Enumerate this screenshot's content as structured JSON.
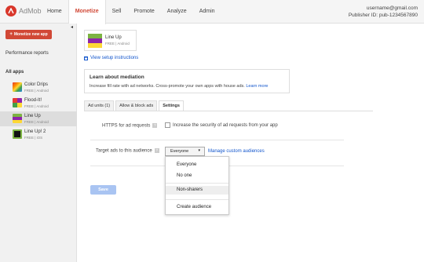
{
  "header": {
    "logo_text": "AdMob",
    "nav": [
      "Home",
      "Monetize",
      "Sell",
      "Promote",
      "Analyze",
      "Admin"
    ],
    "active_nav": "Monetize",
    "email": "username@gmail.com",
    "publisher": "Publisher ID: pub-1234567890"
  },
  "sidebar": {
    "collapse_glyph": "◂",
    "monetize_button": "Monetize new app",
    "performance_reports": "Performance reports",
    "all_apps": "All apps",
    "apps": [
      {
        "name": "Color Drips",
        "sub": "FREE | Android"
      },
      {
        "name": "Flood-It!",
        "sub": "FREE | Android"
      },
      {
        "name": "Line Up",
        "sub": "FREE | Android"
      },
      {
        "name": "Line Up! 2",
        "sub": "FREE | iOS"
      }
    ]
  },
  "main": {
    "app_card": {
      "name": "Line Up",
      "sub": "FREE | Android"
    },
    "setup_link": "View setup instructions",
    "mediation": {
      "title": "Learn about mediation",
      "text": "Increase fill rate with ad networks. Cross-promote your own apps with house ads.",
      "link": "Learn more"
    },
    "tabs": [
      "Ad units (1)",
      "Allow & block ads",
      "Settings"
    ],
    "https": {
      "label": "HTTPS for ad requests",
      "checkbox_label": "Increase the security of ad requests from your app"
    },
    "target": {
      "label": "Target ads to this audience",
      "selected": "Everyone",
      "manage_link": "Manage custom audiences",
      "options": [
        "Everyone",
        "No one",
        "Non-sharers",
        "Create audience"
      ]
    },
    "save": "Save",
    "help_glyph": "?"
  },
  "colors": {
    "accent": "#d14836",
    "link": "#1155cc",
    "save_disabled": "#a9c4f2"
  }
}
